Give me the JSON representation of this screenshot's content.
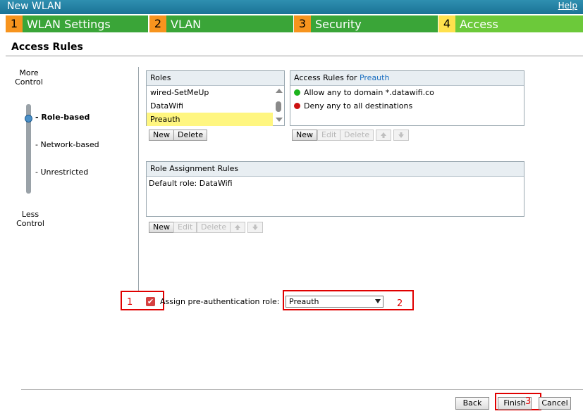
{
  "window": {
    "title": "New WLAN",
    "help_label": "Help"
  },
  "steps": [
    {
      "num": "1",
      "label": "WLAN Settings",
      "num_color": "#f7941e",
      "label_color": "#3aa538"
    },
    {
      "num": "2",
      "label": "VLAN",
      "num_color": "#f7941e",
      "label_color": "#3aa538"
    },
    {
      "num": "3",
      "label": "Security",
      "num_color": "#f7941e",
      "label_color": "#3aa538"
    },
    {
      "num": "4",
      "label": "Access",
      "num_color": "#ffe14d",
      "label_color": "#6cc93a"
    }
  ],
  "section_title": "Access Rules",
  "slider": {
    "top_label_1": "More",
    "top_label_2": "Control",
    "bottom_label_1": "Less",
    "bottom_label_2": "Control",
    "options": [
      "- Role-based",
      "- Network-based",
      "- Unrestricted"
    ],
    "selected": "- Role-based"
  },
  "roles": {
    "header": "Roles",
    "items": [
      "wired-SetMeUp",
      "DataWifi",
      "Preauth"
    ],
    "selected": "Preauth",
    "new_label": "New",
    "delete_label": "Delete"
  },
  "access_rules": {
    "header_prefix": "Access Rules for",
    "header_role": "Preauth",
    "items": [
      {
        "text": "Allow any to domain *.datawifi.co",
        "status": "allow",
        "color": "#1db31d"
      },
      {
        "text": "Deny any to all destinations",
        "status": "deny",
        "color": "#cc1111"
      }
    ],
    "new_label": "New",
    "edit_label": "Edit",
    "delete_label": "Delete",
    "up_icon": "arrow-up-icon",
    "down_icon": "arrow-down-icon"
  },
  "role_assignment": {
    "header": "Role Assignment Rules",
    "default_text": "Default role: DataWifi",
    "new_label": "New",
    "edit_label": "Edit",
    "delete_label": "Delete"
  },
  "preauth": {
    "checkbox_label": "Assign pre-authentication role:",
    "checked": true,
    "select_value": "Preauth"
  },
  "annotations": [
    "1",
    "2",
    "3"
  ],
  "footer": {
    "back_label": "Back",
    "finish_label": "Finish",
    "cancel_label": "Cancel"
  }
}
